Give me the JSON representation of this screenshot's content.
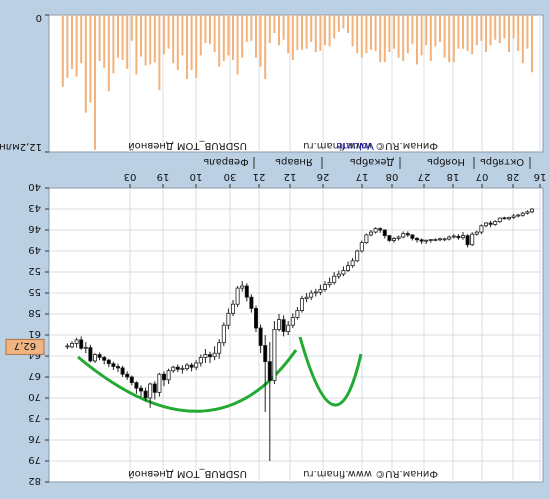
{
  "window": {
    "ticker_label": "USDRUB_TOM Дневной",
    "watermark": "Финам.RU© www.finam.ru",
    "volume_label": "Volume",
    "price_marker": "62,7"
  },
  "colors": {
    "background": "#bcd0e4",
    "plot": "#ffffff",
    "grid": "#d8dde4",
    "volume_bar": "#f2b27a",
    "candle_up": "#ffffff",
    "candle_down": "#000000",
    "annotation": "#22aa33",
    "price_marker": "#f0b483"
  },
  "chart_data": [
    {
      "type": "bar",
      "title": "Volume",
      "ylabel": "",
      "y_ticks": [
        "0",
        "12,2млн"
      ],
      "ylim": [
        0,
        12.2
      ],
      "values_mln": [
        5.1,
        3.0,
        4.3,
        3.2,
        2.1,
        3.3,
        2.1,
        2.5,
        2.2,
        2.7,
        3.3,
        2.3,
        2.7,
        3.5,
        3.2,
        3.0,
        3.0,
        4.2,
        4.2,
        3.8,
        2.4,
        2.8,
        4.1,
        2.7,
        3.6,
        4.4,
        2.6,
        3.4,
        4.1,
        3.8,
        3.0,
        3.3,
        4.2,
        4.2,
        3.2,
        3.1,
        3.4,
        3.8,
        3.4,
        2.8,
        1.6,
        1.2,
        1.5,
        2.1,
        2.8,
        2.7,
        3.2,
        3.3,
        2.4,
        3.0,
        3.1,
        3.1,
        4.0,
        3.4,
        2.2,
        2.7,
        1.6,
        2.5,
        5.7,
        4.6,
        3.8,
        2.3,
        2.4,
        3.8,
        5.3,
        4.0,
        3.6,
        4.1,
        4.6,
        3.3,
        2.6,
        2.5,
        3.6,
        5.6,
        4.9,
        5.7,
        3.6,
        4.9,
        4.3,
        3.0,
        3.5,
        6.7,
        4.2,
        4.4,
        4.5,
        3.7,
        5.3,
        2.3,
        4.8,
        4.0,
        3.8,
        5.2,
        6.8,
        4.7,
        4.1,
        12.0,
        7.8,
        8.7,
        4.3,
        5.5,
        4.8,
        5.6,
        6.4
      ]
    },
    {
      "type": "candlestick",
      "title": "USDRUB_TOM Дневной",
      "x_ticks": [
        "16",
        "28",
        "07",
        "18",
        "27",
        "08",
        "17",
        "26",
        "12",
        "21",
        "30",
        "10",
        "19",
        "03"
      ],
      "x_months": [
        "Октябрь",
        "Ноябрь",
        "Декабрь",
        "Январь",
        "Февраль"
      ],
      "y_ticks": [
        "40",
        "43",
        "46",
        "49",
        "52",
        "55",
        "58",
        "61",
        "64",
        "67",
        "70",
        "73",
        "76",
        "79",
        "82"
      ],
      "ylim": [
        40,
        82
      ],
      "last_price": 62.7,
      "candles_ohlc": [
        [
          43.0,
          43.6,
          42.9,
          43.4
        ],
        [
          43.4,
          43.8,
          43.2,
          43.6
        ],
        [
          43.6,
          44.1,
          43.4,
          43.9
        ],
        [
          43.9,
          44.2,
          43.7,
          44.0
        ],
        [
          44.0,
          44.4,
          43.7,
          44.2
        ],
        [
          44.2,
          44.6,
          44.1,
          44.4
        ],
        [
          44.4,
          44.5,
          44.1,
          44.3
        ],
        [
          44.3,
          45.0,
          44.2,
          44.8
        ],
        [
          44.8,
          45.4,
          44.6,
          45.2
        ],
        [
          45.2,
          45.6,
          44.7,
          45.0
        ],
        [
          45.0,
          45.6,
          44.9,
          45.4
        ],
        [
          45.4,
          46.6,
          45.2,
          46.3
        ],
        [
          46.3,
          46.8,
          46.1,
          46.6
        ],
        [
          46.6,
          48.3,
          46.3,
          48.1
        ],
        [
          48.1,
          48.5,
          46.6,
          46.8
        ],
        [
          46.8,
          47.4,
          46.3,
          47.1
        ],
        [
          47.1,
          47.4,
          46.6,
          46.9
        ],
        [
          46.9,
          47.2,
          46.6,
          47.0
        ],
        [
          47.0,
          47.5,
          46.8,
          47.3
        ],
        [
          47.3,
          47.6,
          47.1,
          47.4
        ],
        [
          47.4,
          47.6,
          47.1,
          47.4
        ],
        [
          47.4,
          47.6,
          47.2,
          47.5
        ],
        [
          47.5,
          47.8,
          47.3,
          47.5
        ],
        [
          47.5,
          48.0,
          47.4,
          47.6
        ],
        [
          47.6,
          48.0,
          47.2,
          47.4
        ],
        [
          47.4,
          47.8,
          47.0,
          47.2
        ],
        [
          47.2,
          47.5,
          46.6,
          46.7
        ],
        [
          46.7,
          47.0,
          46.2,
          46.5
        ],
        [
          46.5,
          47.2,
          46.2,
          47.0
        ],
        [
          47.0,
          47.5,
          46.8,
          47.2
        ],
        [
          47.2,
          47.8,
          47.0,
          47.5
        ],
        [
          47.5,
          47.7,
          46.7,
          46.8
        ],
        [
          46.8,
          47.2,
          45.9,
          46.0
        ],
        [
          46.0,
          46.4,
          45.6,
          45.8
        ],
        [
          45.8,
          46.5,
          45.6,
          46.3
        ],
        [
          46.3,
          46.9,
          46.0,
          46.7
        ],
        [
          46.7,
          48.0,
          46.5,
          47.8
        ],
        [
          47.8,
          49.2,
          47.5,
          49.0
        ],
        [
          49.0,
          50.6,
          48.8,
          50.4
        ],
        [
          50.4,
          51.4,
          50.0,
          51.1
        ],
        [
          51.1,
          52.0,
          50.5,
          51.8
        ],
        [
          51.8,
          52.6,
          51.2,
          52.3
        ],
        [
          52.3,
          53.0,
          51.8,
          52.6
        ],
        [
          52.6,
          53.8,
          52.0,
          53.5
        ],
        [
          53.5,
          54.2,
          52.8,
          53.8
        ],
        [
          53.8,
          54.8,
          53.3,
          54.5
        ],
        [
          54.5,
          55.3,
          53.8,
          54.9
        ],
        [
          54.9,
          55.5,
          54.4,
          55.0
        ],
        [
          55.0,
          56.0,
          54.6,
          55.6
        ],
        [
          55.6,
          56.3,
          55.0,
          55.8
        ],
        [
          55.8,
          57.8,
          55.4,
          57.5
        ],
        [
          57.5,
          58.8,
          57.0,
          58.5
        ],
        [
          58.5,
          60.0,
          57.9,
          59.6
        ],
        [
          59.6,
          61.0,
          59.0,
          60.5
        ],
        [
          60.5,
          61.2,
          58.2,
          58.8
        ],
        [
          58.8,
          60.5,
          58.0,
          60.2
        ],
        [
          60.2,
          68.0,
          59.0,
          67.5
        ],
        [
          67.5,
          79.0,
          62.0,
          64.8
        ],
        [
          64.8,
          72.0,
          61.0,
          62.5
        ],
        [
          62.5,
          63.6,
          59.5,
          60.0
        ],
        [
          60.0,
          60.6,
          56.8,
          57.2
        ],
        [
          57.2,
          57.8,
          55.2,
          55.6
        ],
        [
          55.6,
          56.2,
          53.6,
          54.0
        ],
        [
          54.0,
          54.8,
          53.3,
          54.3
        ],
        [
          54.3,
          57.0,
          54.0,
          56.6
        ],
        [
          56.6,
          58.3,
          56.0,
          57.9
        ],
        [
          57.9,
          60.2,
          57.2,
          59.6
        ],
        [
          59.6,
          62.6,
          59.2,
          62.1
        ],
        [
          62.1,
          64.4,
          61.6,
          63.6
        ],
        [
          63.6,
          64.6,
          62.6,
          64.1
        ],
        [
          64.1,
          65.0,
          63.4,
          63.8
        ],
        [
          63.8,
          65.0,
          63.0,
          64.2
        ],
        [
          64.2,
          65.5,
          63.8,
          65.0
        ],
        [
          65.0,
          66.0,
          64.6,
          65.6
        ],
        [
          65.6,
          66.2,
          65.0,
          65.3
        ],
        [
          65.3,
          66.1,
          65.0,
          65.8
        ],
        [
          65.8,
          66.5,
          65.3,
          65.9
        ],
        [
          65.9,
          66.3,
          65.2,
          65.6
        ],
        [
          65.6,
          66.4,
          65.4,
          66.1
        ],
        [
          66.1,
          68.0,
          65.8,
          67.4
        ],
        [
          67.4,
          68.3,
          66.2,
          66.6
        ],
        [
          66.6,
          69.8,
          66.4,
          69.2
        ],
        [
          69.2,
          70.2,
          67.6,
          68.0
        ],
        [
          68.0,
          71.4,
          67.8,
          70.0
        ],
        [
          70.0,
          70.5,
          68.5,
          69.0
        ],
        [
          69.0,
          69.9,
          68.2,
          68.6
        ],
        [
          68.6,
          69.4,
          67.6,
          67.8
        ],
        [
          67.8,
          68.2,
          66.8,
          67.0
        ],
        [
          67.0,
          67.4,
          66.2,
          66.6
        ],
        [
          66.6,
          67.0,
          65.4,
          65.7
        ],
        [
          65.7,
          66.3,
          65.1,
          65.5
        ],
        [
          65.5,
          66.0,
          64.8,
          65.1
        ],
        [
          65.1,
          65.6,
          64.4,
          64.6
        ],
        [
          64.6,
          65.2,
          64.0,
          64.2
        ],
        [
          64.2,
          64.6,
          63.5,
          63.8
        ],
        [
          63.8,
          65.0,
          63.6,
          64.7
        ],
        [
          64.7,
          64.9,
          62.4,
          62.8
        ],
        [
          62.8,
          63.6,
          62.0,
          62.9
        ],
        [
          62.9,
          63.1,
          61.2,
          61.7
        ],
        [
          61.7,
          62.8,
          61.4,
          62.2
        ],
        [
          62.2,
          62.9,
          61.9,
          62.7
        ],
        [
          62.7,
          63.0,
          62.2,
          62.7
        ]
      ]
    }
  ]
}
